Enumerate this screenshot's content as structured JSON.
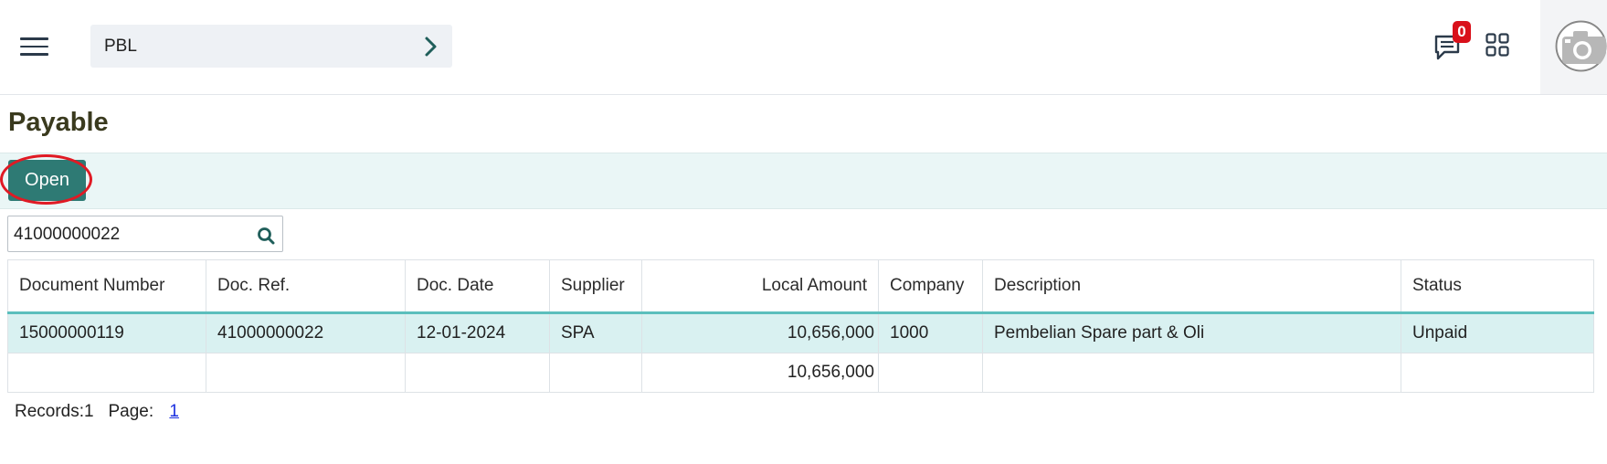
{
  "header": {
    "breadcrumb": "PBL",
    "notification_count": "0"
  },
  "page": {
    "title": "Payable"
  },
  "toolbar": {
    "open_label": "Open"
  },
  "search": {
    "value": "41000000022"
  },
  "table": {
    "columns": [
      "Document Number",
      "Doc. Ref.",
      "Doc. Date",
      "Supplier",
      "Local Amount",
      "Company",
      "Description",
      "Status"
    ],
    "rows": [
      [
        "15000000119",
        "41000000022",
        "12-01-2024",
        "SPA",
        "10,656,000",
        "1000",
        "Pembelian Spare part & Oli",
        "Unpaid"
      ]
    ],
    "total": {
      "local_amount": "10,656,000"
    }
  },
  "footer": {
    "records": "Records:1",
    "page_label": "Page:",
    "page_link": "1"
  },
  "colors": {
    "accent": "#2e7a74",
    "badge": "#d9101a",
    "selected_row": "#d9f1f1",
    "highlight_ring": "#e01a24"
  }
}
